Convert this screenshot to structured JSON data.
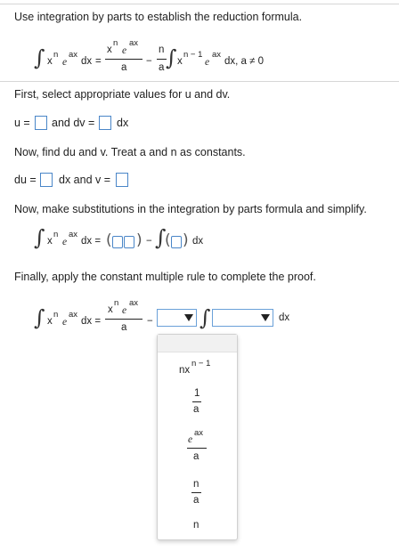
{
  "problem": {
    "instruction": "Use integration by parts to establish the reduction formula.",
    "formula": {
      "integral": "∫",
      "x": "x",
      "n": "n",
      "e": "e",
      "ax": "ax",
      "dx": "dx",
      "eq": "=",
      "frac1_num_x": "x",
      "frac1_num_n": "n",
      "frac1_num_e": "e",
      "frac1_num_ax": "ax",
      "frac1_den": "a",
      "minus": "−",
      "frac2_num": "n",
      "frac2_den": "a",
      "x2": "x",
      "n_minus_1": "n − 1",
      "e2": "e",
      "ax2": "ax",
      "tail": "dx, a ≠ 0"
    }
  },
  "steps": {
    "step1_text": "First, select appropriate values for u and dv.",
    "u_label": "u =",
    "dv_label": "and dv =",
    "dx_label": "dx",
    "step2_text": "Now, find du and v. Treat a and n as constants.",
    "du_label": "du =",
    "dx_and_v_label": "dx and v =",
    "step3_text": "Now, make substitutions in the integration by parts formula and simplify.",
    "step3_formula": {
      "integral": "∫",
      "x": "x",
      "n": "n",
      "e": "e",
      "ax": "ax",
      "dx_eq": "dx =",
      "lparen": "(",
      "rparen": ")",
      "minus": "−",
      "integral2": "∫",
      "lparen2": "(",
      "rparen2": ")",
      "dx": "dx"
    },
    "step4_text": "Finally, apply the constant multiple rule to complete the proof.",
    "step4_formula": {
      "integral": "∫",
      "x": "x",
      "n": "n",
      "e": "e",
      "ax": "ax",
      "dx_eq": "dx =",
      "num_x": "x",
      "num_n": "n",
      "num_e": "e",
      "num_ax": "ax",
      "den": "a",
      "minus": "−",
      "integral2": "∫",
      "dx": "dx"
    }
  },
  "dropdown_menu": {
    "options": [
      {
        "name": "nx^(n-1)",
        "base": "nx",
        "sup": "n − 1"
      },
      {
        "name": "1/a",
        "num": "1",
        "den": "a"
      },
      {
        "name": "e^ax/a",
        "num_base": "e",
        "num_sup": "ax",
        "den": "a"
      },
      {
        "name": "n/a",
        "num": "n",
        "den": "a"
      },
      {
        "name": "n",
        "text": "n"
      }
    ]
  },
  "colors": {
    "input_border": "#4a86c8",
    "dropdown_border": "#6aa0d8",
    "rule": "#d6d6d6"
  }
}
